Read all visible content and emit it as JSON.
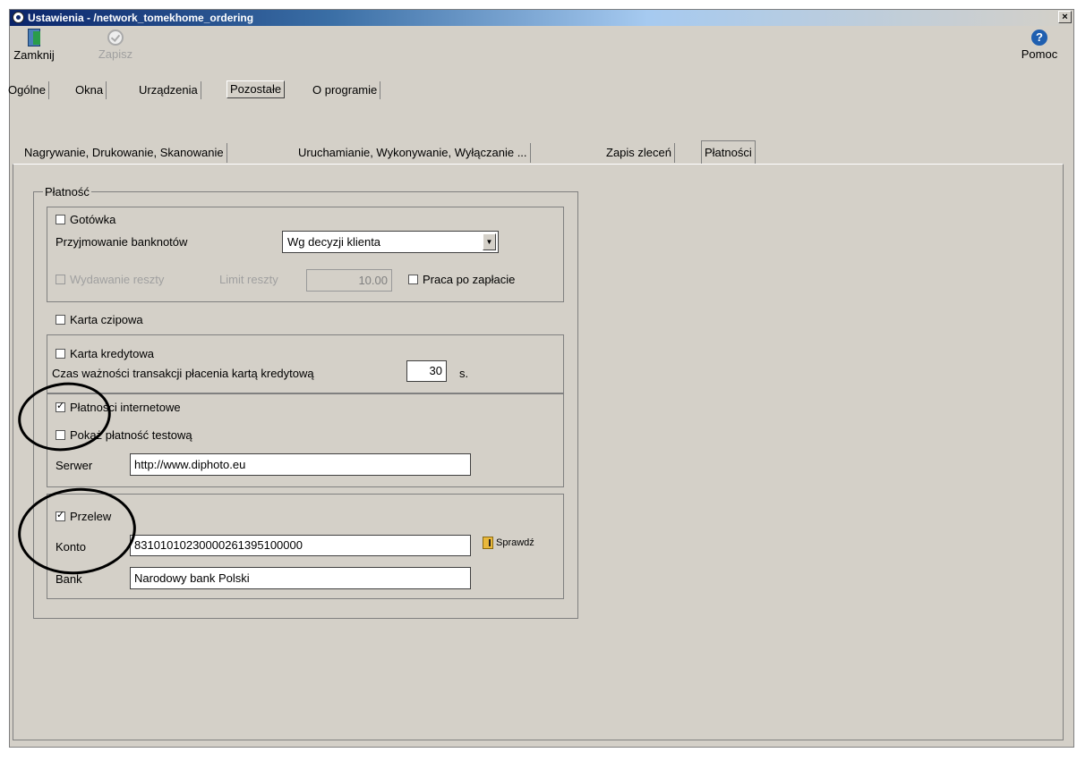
{
  "window": {
    "title": "Ustawienia - /network_tomekhome_ordering",
    "close_glyph": "×"
  },
  "toolbar": {
    "close_label": "Zamknij",
    "save_label": "Zapisz",
    "help_label": "Pomoc",
    "help_glyph": "?"
  },
  "tabs_top": [
    "Ogólne",
    "Okna",
    "Urządzenia",
    "Pozostałe",
    "O programie"
  ],
  "tabs_sub": [
    "Nagrywanie, Drukowanie, Skanowanie",
    "Uruchamianie, Wykonywanie, Wyłączanie ...",
    "Zapis zleceń",
    "Płatności"
  ],
  "payment": {
    "legend": "Płatność",
    "cash": {
      "label": "Gotówka",
      "checked": false,
      "banknotes_label": "Przyjmowanie banknotów",
      "banknotes_value": "Wg decyzji klienta",
      "change_label": "Wydawanie reszty",
      "change_limit_label": "Limit reszty",
      "change_limit_value": "10.00",
      "work_after_label": "Praca po zapłacie"
    },
    "chip_card": {
      "label": "Karta czipowa",
      "checked": false
    },
    "credit_card": {
      "label": "Karta kredytowa",
      "checked": false,
      "timeout_label": "Czas ważności transakcji płacenia kartą kredytową",
      "timeout_value": "30",
      "timeout_unit": "s."
    },
    "internet": {
      "label": "Płatności internetowe",
      "checked": true,
      "test_label": "Pokaż płatność testową",
      "server_label": "Serwer",
      "server_value": "http://www.diphoto.eu"
    },
    "transfer": {
      "label": "Przelew",
      "checked": true,
      "account_label": "Konto",
      "account_value": "83101010230000261395100000",
      "check_label": "Sprawdź",
      "bank_label": "Bank",
      "bank_value": "Narodowy bank Polski"
    }
  }
}
